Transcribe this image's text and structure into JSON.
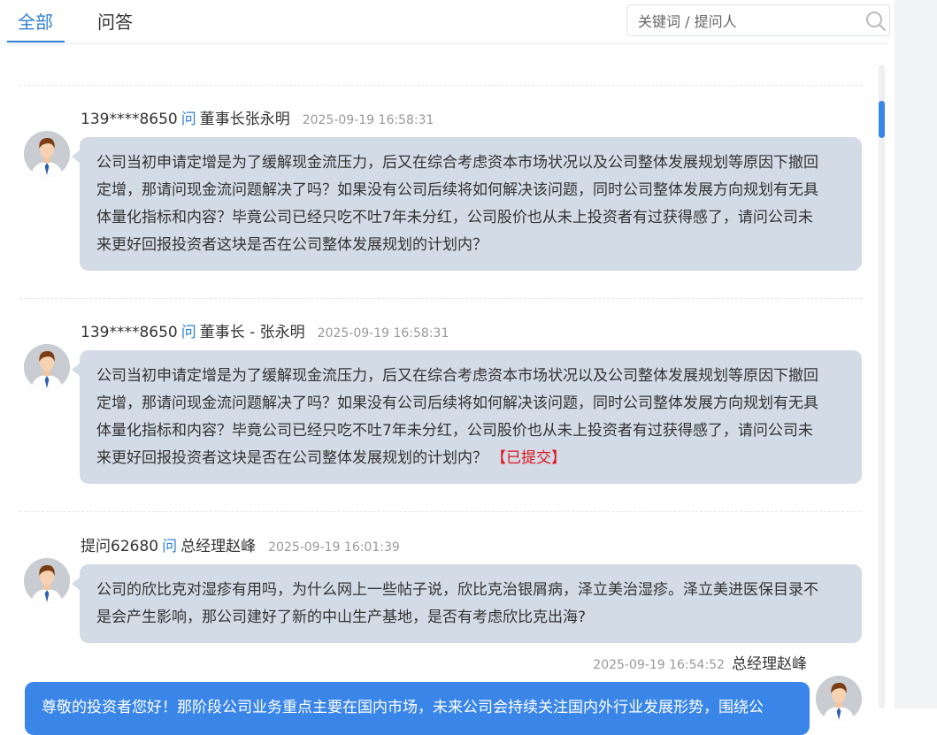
{
  "tabs": [
    {
      "label": "全部",
      "active": true
    },
    {
      "label": "问答",
      "active": false
    }
  ],
  "search": {
    "placeholder": "关键词 / 提问人",
    "value": ""
  },
  "colors": {
    "accent": "#2f7fd3",
    "bubble": "#d3dbe6",
    "answer_bubble": "#3a86e8",
    "status": "#e0141e"
  },
  "questions": [
    {
      "asker": "139****8650",
      "ask_word": "问",
      "target": "董事长张永明",
      "time": "2025-09-19 16:58:31",
      "lines": [
        "公司当初申请定增是为了缓解现金流压力，后又在综合考虑资本市场状况以及公司整体发展规划等原因下撤回",
        "定增，那请问现金流问题解决了吗？如果没有公司后续将如何解决该问题，同时公司整体发展方向规划有无具",
        "体量化指标和内容？毕竟公司已经只吃不吐7年未分红，公司股价也从未上投资者有过获得感了，请问公司未",
        "来更好回报投资者这块是否在公司整体发展规划的计划内？"
      ],
      "status": ""
    },
    {
      "asker": "139****8650",
      "ask_word": "问",
      "target": "董事长 - 张永明",
      "time": "2025-09-19 16:58:31",
      "lines": [
        "公司当初申请定增是为了缓解现金流压力，后又在综合考虑资本市场状况以及公司整体发展规划等原因下撤回",
        "定增，那请问现金流问题解决了吗？如果没有公司后续将如何解决该问题，同时公司整体发展方向规划有无具",
        "体量化指标和内容？毕竟公司已经只吃不吐7年未分红，公司股价也从未上投资者有过获得感了，请问公司未",
        "来更好回报投资者这块是否在公司整体发展规划的计划内？"
      ],
      "status": "【已提交】"
    },
    {
      "asker": "提问62680",
      "ask_word": "问",
      "target": "总经理赵峰",
      "time": "2025-09-19 16:01:39",
      "lines": [
        "公司的欣比克对湿疹有用吗，为什么网上一些帖子说，欣比克治银屑病，泽立美治湿疹。泽立美进医保目录不",
        "是会产生影响，那公司建好了新的中山生产基地，是否有考虑欣比克出海?"
      ],
      "status": ""
    }
  ],
  "answer": {
    "time": "2025-09-19 16:54:52",
    "responder": "总经理赵峰",
    "text": "尊敬的投资者您好！那阶段公司业务重点主要在国内市场，未来公司会持续关注国内外行业发展形势，围绕公"
  },
  "icons": {
    "search": "search-icon",
    "avatar": "user-avatar-icon"
  }
}
